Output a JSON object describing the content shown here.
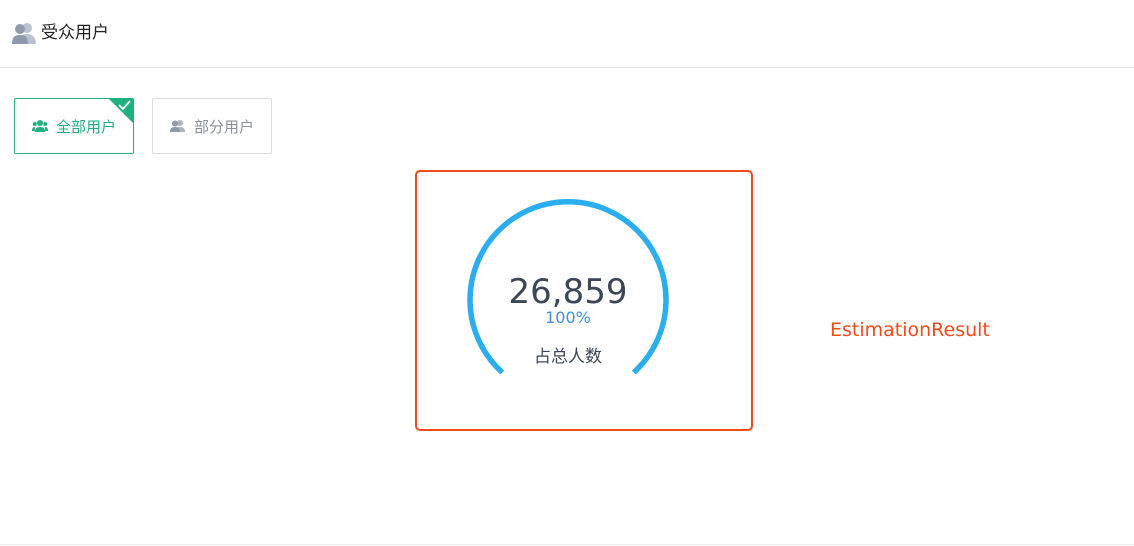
{
  "header": {
    "icon": "users-icon",
    "title": "受众用户"
  },
  "audience_options": [
    {
      "label": "全部用户",
      "icon": "users-group-icon",
      "selected": true
    },
    {
      "label": "部分用户",
      "icon": "user-pair-icon",
      "selected": false
    }
  ],
  "estimation": {
    "value": "26,859",
    "percent": "100%",
    "label": "占总人数",
    "gauge_fill": 1.0
  },
  "result_label": "EstimationResult",
  "colors": {
    "accent_green": "#1fb07f",
    "gauge_blue": "#2aaef0",
    "percent_blue": "#3f8fe7",
    "highlight_red": "#f04a1d"
  }
}
